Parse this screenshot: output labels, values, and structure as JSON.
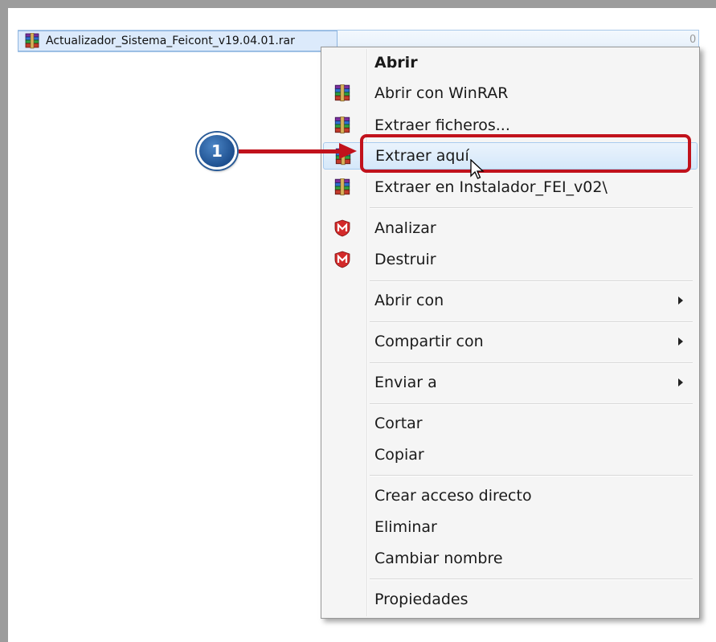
{
  "file": {
    "name": "Actualizador_Sistema_Feicont_v19.04.01.rar",
    "column_hint": "0"
  },
  "callout": {
    "number": "1"
  },
  "menu": {
    "open": "Abrir",
    "open_winrar": "Abrir con WinRAR",
    "extract_files": "Extraer ficheros...",
    "extract_here": "Extraer aquí",
    "extract_to": "Extraer en Instalador_FEI_v02\\",
    "scan": "Analizar",
    "shred": "Destruir",
    "open_with": "Abrir con",
    "share_with": "Compartir con",
    "send_to": "Enviar a",
    "cut": "Cortar",
    "copy": "Copiar",
    "create_shortcut": "Crear acceso directo",
    "delete": "Eliminar",
    "rename": "Cambiar nombre",
    "properties": "Propiedades"
  },
  "colors": {
    "callout_red": "#c1121c",
    "badge_blue": "#1d4f8f",
    "highlight": "#d5e8fa"
  }
}
